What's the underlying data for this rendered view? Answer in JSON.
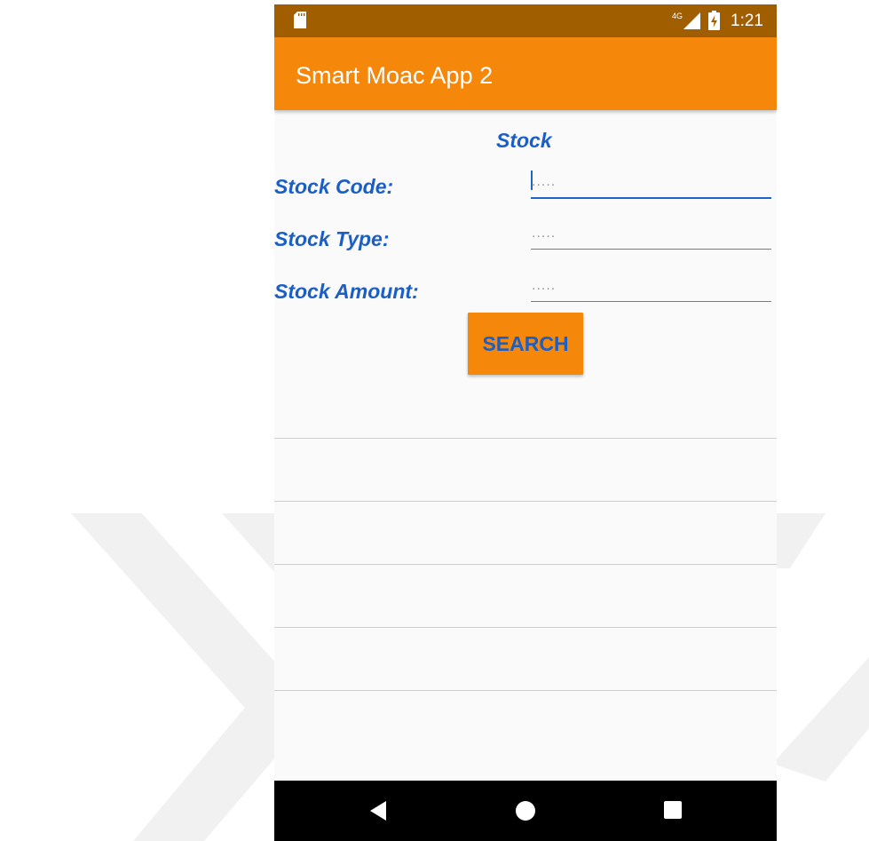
{
  "status_bar": {
    "time": "1:21",
    "network_badge": "4G",
    "icons": [
      "sd-card-icon",
      "signal-icon",
      "battery-charging-icon"
    ]
  },
  "app_bar": {
    "title": "Smart Moac App 2"
  },
  "form": {
    "title": "Stock",
    "fields": [
      {
        "label": "Stock Code:",
        "value": "",
        "placeholder": "....."
      },
      {
        "label": "Stock Type:",
        "value": "",
        "placeholder": "....."
      },
      {
        "label": "Stock Amount:",
        "value": "",
        "placeholder": "....."
      }
    ],
    "search_label": "SEARCH"
  },
  "results": {
    "rows": [
      "",
      "",
      "",
      "",
      ""
    ]
  },
  "nav_bar": {
    "icons": [
      "back-icon",
      "home-icon",
      "recents-icon"
    ]
  },
  "colors": {
    "status_bar": "#a05e00",
    "accent": "#f5870b",
    "label_text": "#1c5fc4",
    "nav_bar": "#000000"
  }
}
